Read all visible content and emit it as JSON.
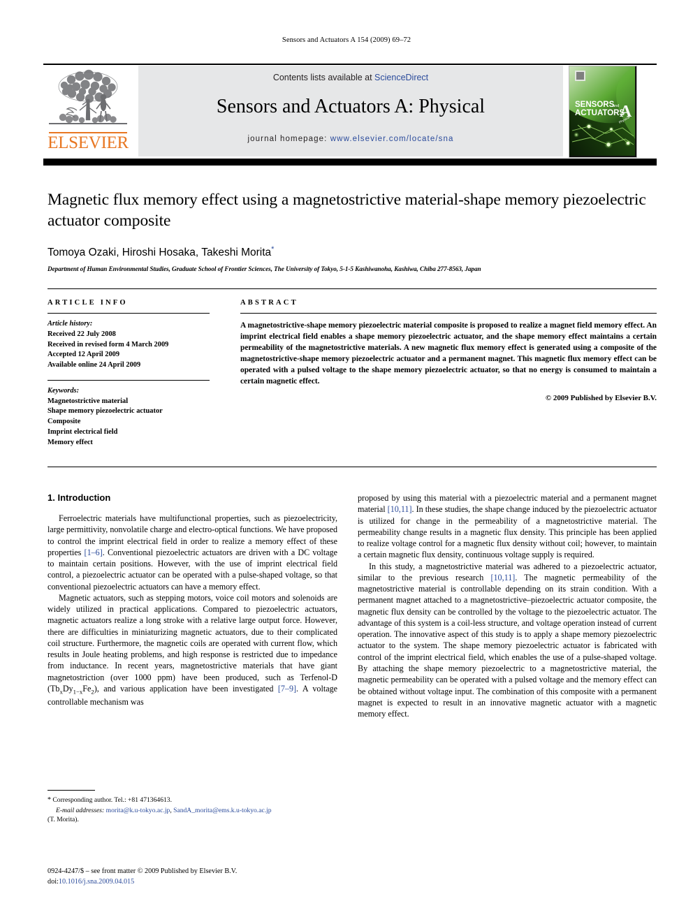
{
  "running_head": "Sensors and Actuators A 154 (2009) 69–72",
  "masthead": {
    "publisher_name": "ELSEVIER",
    "contents_prefix": "Contents lists available at ",
    "contents_link": "ScienceDirect",
    "journal_title": "Sensors and Actuators A: Physical",
    "homepage_prefix": "journal homepage: ",
    "homepage_url": "www.elsevier.com/locate/sna",
    "cover": {
      "line1": "SENSORS",
      "line1_sub": "and",
      "line2": "ACTUATORS",
      "letter": "A",
      "letter_sub": "Physical"
    }
  },
  "article": {
    "title": "Magnetic flux memory effect using a magnetostrictive material-shape memory piezoelectric actuator composite",
    "authors": "Tomoya Ozaki, Hiroshi Hosaka, Takeshi Morita",
    "corresponding_marker": "*",
    "affiliation": "Department of Human Environmental Studies, Graduate School of Frontier Sciences, The University of Tokyo, 5-1-5 Kashiwanoha, Kashiwa, Chiba 277-8563, Japan"
  },
  "article_info": {
    "heading": "ARTICLE INFO",
    "history_label": "Article history:",
    "history": [
      "Received 22 July 2008",
      "Received in revised form 4 March 2009",
      "Accepted 12 April 2009",
      "Available online 24 April 2009"
    ],
    "keywords_label": "Keywords:",
    "keywords": [
      "Magnetostrictive material",
      "Shape memory piezoelectric actuator",
      "Composite",
      "Imprint electrical field",
      "Memory effect"
    ]
  },
  "abstract": {
    "heading": "ABSTRACT",
    "text": "A magnetostrictive-shape memory piezoelectric material composite is proposed to realize a magnet field memory effect. An imprint electrical field enables a shape memory piezoelectric actuator, and the shape memory effect maintains a certain permeability of the magnetostrictive materials. A new magnetic flux memory effect is generated using a composite of the magnetostrictive-shape memory piezoelectric actuator and a permanent magnet. This magnetic flux memory effect can be operated with a pulsed voltage to the shape memory piezoelectric actuator, so that no energy is consumed to maintain a certain magnetic effect.",
    "copyright": "© 2009 Published by Elsevier B.V."
  },
  "body": {
    "section_heading": "1. Introduction",
    "left_paragraph_1_a": "Ferroelectric materials have multifunctional properties, such as piezoelectricity, large permittivity, nonvolatile charge and electro-optical functions. We have proposed to control the imprint electrical field in order to realize a memory effect of these properties ",
    "left_paragraph_1_ref": "[1–6]",
    "left_paragraph_1_b": ". Conventional piezoelectric actuators are driven with a DC voltage to maintain certain positions. However, with the use of imprint electrical field control, a piezoelectric actuator can be operated with a pulse-shaped voltage, so that conventional piezoelectric actuators can have a memory effect.",
    "left_paragraph_2_a": "Magnetic actuators, such as stepping motors, voice coil motors and solenoids are widely utilized in practical applications. Compared to piezoelectric actuators, magnetic actuators realize a long stroke with a relative large output force. However, there are difficulties in miniaturizing magnetic actuators, due to their complicated coil structure. Furthermore, the magnetic coils are operated with current flow, which results in Joule heating problems, and high response is restricted due to impedance from inductance. In recent years, magnetostrictive materials that have giant magnetostriction (over 1000 ppm) have been produced, such as Terfenol-D (Tb",
    "left_paragraph_2_sub1": "x",
    "left_paragraph_2_b": "Dy",
    "left_paragraph_2_sub2": "1−x",
    "left_paragraph_2_c": "Fe",
    "left_paragraph_2_sub3": "2",
    "left_paragraph_2_d": "), and various application have been investigated ",
    "left_paragraph_2_ref": "[7–9]",
    "left_paragraph_2_e": ". A voltage controllable mechanism was",
    "right_paragraph_1_a": "proposed by using this material with a piezoelectric material and a permanent magnet material ",
    "right_paragraph_1_ref": "[10,11]",
    "right_paragraph_1_b": ". In these studies, the shape change induced by the piezoelectric actuator is utilized for change in the permeability of a magnetostrictive material. The permeability change results in a magnetic flux density. This principle has been applied to realize voltage control for a magnetic flux density without coil; however, to maintain a certain magnetic flux density, continuous voltage supply is required.",
    "right_paragraph_2_a": "In this study, a magnetostrictive material was adhered to a piezoelectric actuator, similar to the previous research ",
    "right_paragraph_2_ref": "[10,11]",
    "right_paragraph_2_b": ". The magnetic permeability of the magnetostrictive material is controllable depending on its strain condition. With a permanent magnet attached to a magnetostrictive–piezoelectric actuator composite, the magnetic flux density can be controlled by the voltage to the piezoelectric actuator. The advantage of this system is a coil-less structure, and voltage operation instead of current operation. The innovative aspect of this study is to apply a shape memory piezoelectric actuator to the system. The shape memory piezoelectric actuator is fabricated with control of the imprint electrical field, which enables the use of a pulse-shaped voltage. By attaching the shape memory piezoelectric to a magnetostrictive material, the magnetic permeability can be operated with a pulsed voltage and the memory effect can be obtained without voltage input. The combination of this composite with a permanent magnet is expected to result in an innovative magnetic actuator with a magnetic memory effect."
  },
  "footnotes": {
    "star": "*",
    "corresponding": "Corresponding author. Tel.: +81 471364613.",
    "email_label": "E-mail addresses:",
    "email_1": "morita@k.u-tokyo.ac.jp",
    "email_sep": ", ",
    "email_2": "SandA_morita@ems.k.u-tokyo.ac.jp",
    "email_suffix": "(T. Morita)."
  },
  "footer": {
    "front_matter": "0924-4247/$ – see front matter © 2009 Published by Elsevier B.V.",
    "doi_label": "doi:",
    "doi_value": "10.1016/j.sna.2009.04.015"
  },
  "colors": {
    "link": "#2b4b9b",
    "elsevier_orange": "#e87722",
    "masthead_grey": "#e6e7e8"
  }
}
